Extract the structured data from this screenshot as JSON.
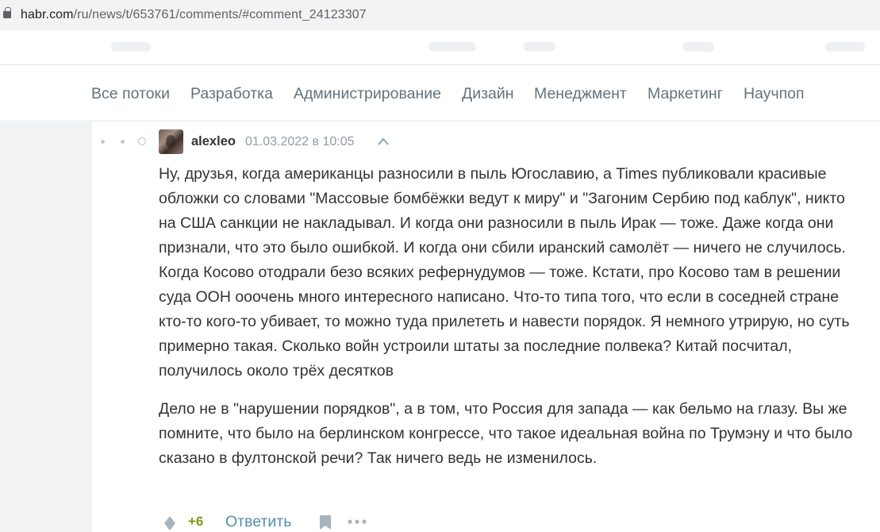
{
  "browser": {
    "url_host": "habr.com",
    "url_path": "/ru/news/t/653761/comments/#comment_24123307"
  },
  "flows": [
    {
      "label": "Все потоки"
    },
    {
      "label": "Разработка"
    },
    {
      "label": "Администрирование"
    },
    {
      "label": "Дизайн"
    },
    {
      "label": "Менеджмент"
    },
    {
      "label": "Маркетинг"
    },
    {
      "label": "Научпоп"
    }
  ],
  "comment": {
    "username": "alexleo",
    "timestamp": "01.03.2022 в 10:05",
    "paragraphs": [
      "Ну, друзья, когда американцы разносили в пыль Югославию, а Times публиковали красивые обложки со словами \"Массовые бомбёжки ведут к миру\" и \"Загоним Сербию под каблук\", никто на США санкции не накладывал. И когда они разносили в пыль Ирак — тоже. Даже когда они признали, что это было ошибкой. И когда они сбили иранский самолёт — ничего не случилось. Когда Косово отодрали безо всяких рефернудумов — тоже. Кстати, про Косово там в решении суда ООН ооочень много интересного написано. Что-то типа того, что если в соседней стране кто-то кого-то убивает, то можно туда прилететь и навести порядок. Я немного утрирую, но суть примерно такая. Сколько войн устроили штаты за последние полвека? Китай посчитал, получилось около трёх десятков",
      "Дело не в \"нарушении порядков\", а в том, что Россия для запада — как бельмо на глазу. Вы же помните, что было на берлинском конгрессе, что такое идеальная война по Трумэну и что было сказано в фултонской речи? Так ничего ведь не изменилось."
    ],
    "score": "+6",
    "reply_label": "Ответить"
  },
  "icons": {
    "lock": "lock-icon",
    "collapse": "chevron-up-icon",
    "vote": "vote-diamond-icon",
    "bookmark": "bookmark-icon",
    "more": "more-dots-icon"
  },
  "colors": {
    "link": "#548eaa",
    "score_positive": "#7b9c1c",
    "nav_text": "#65727a",
    "muted": "#929ca5"
  }
}
